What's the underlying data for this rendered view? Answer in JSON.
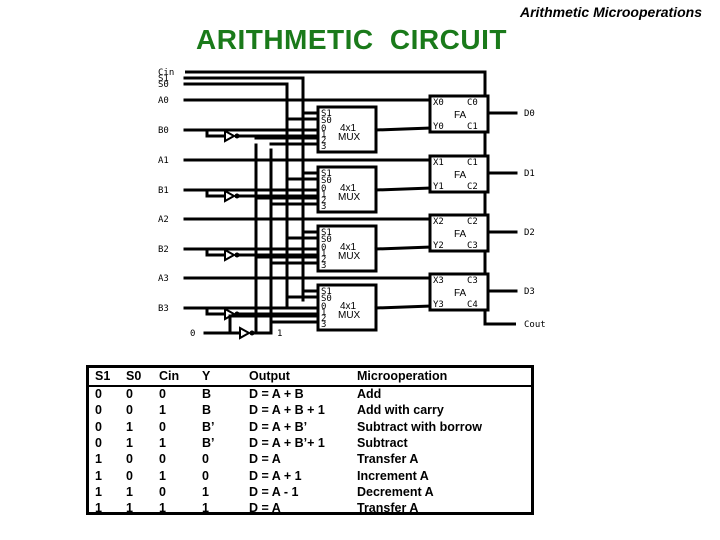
{
  "header": {
    "slide_title": "Arithmetic Microoperations"
  },
  "diagram": {
    "title": "ARITHMETIC  CIRCUIT",
    "control_inputs": [
      "Cin",
      "S1",
      "S0"
    ],
    "stages": [
      {
        "a": "A0",
        "b": "B0",
        "x": "X0",
        "y": "Y0",
        "cin": "C0",
        "cout": "C1",
        "out": "D0"
      },
      {
        "a": "A1",
        "b": "B1",
        "x": "X1",
        "y": "Y1",
        "cin": "C1",
        "cout": "C2",
        "out": "D1"
      },
      {
        "a": "A2",
        "b": "B2",
        "x": "X2",
        "y": "Y2",
        "cin": "C2",
        "cout": "C3",
        "out": "D2"
      },
      {
        "a": "A3",
        "b": "B3",
        "x": "X3",
        "y": "Y3",
        "cin": "C3",
        "cout": "C4",
        "out": "D3"
      }
    ],
    "mux": {
      "sel1": "S1",
      "sel0": "S0",
      "inputs": [
        "0",
        "1",
        "2",
        "3"
      ],
      "name_line1": "4x1",
      "name_line2": "MUX"
    },
    "fa_label": "FA",
    "cout_label": "Cout",
    "const_zero": "0",
    "const_one": "1"
  },
  "table": {
    "headers": [
      "S1",
      "S0",
      "Cin",
      "Y",
      "Output",
      "Microoperation"
    ],
    "rows": [
      [
        "0",
        "0",
        "0",
        "B",
        "D = A + B",
        "Add"
      ],
      [
        "0",
        "0",
        "1",
        "B",
        "D = A + B + 1",
        "Add with carry"
      ],
      [
        "0",
        "1",
        "0",
        "B’",
        "D = A + B’",
        "Subtract with borrow"
      ],
      [
        "0",
        "1",
        "1",
        "B’",
        "D = A + B’+ 1",
        "Subtract"
      ],
      [
        "1",
        "0",
        "0",
        "0",
        "D = A",
        "Transfer A"
      ],
      [
        "1",
        "0",
        "1",
        "0",
        "D = A + 1",
        "Increment A"
      ],
      [
        "1",
        "1",
        "0",
        "1",
        "D = A - 1",
        "Decrement A"
      ],
      [
        "1",
        "1",
        "1",
        "1",
        "D = A",
        "Transfer A"
      ]
    ]
  }
}
